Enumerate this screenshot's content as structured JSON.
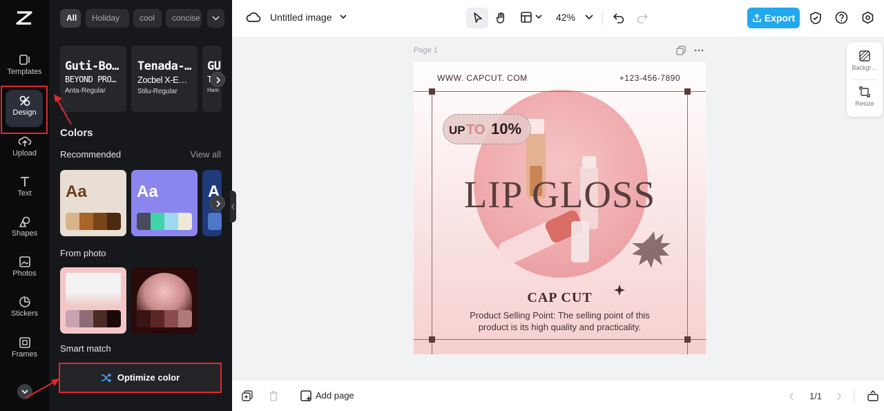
{
  "rail": {
    "items": [
      {
        "label": "Templates"
      },
      {
        "label": "Design"
      },
      {
        "label": "Upload"
      },
      {
        "label": "Text"
      },
      {
        "label": "Shapes"
      },
      {
        "label": "Photos"
      },
      {
        "label": "Stickers"
      },
      {
        "label": "Frames"
      }
    ],
    "active": "Design"
  },
  "panel": {
    "chips": [
      "All",
      "Holiday",
      "cool",
      "concise"
    ],
    "font_cards": [
      {
        "line1": "Guti-Bo…",
        "line2": "BEYOND PRO…",
        "line3": "Anta-Regular"
      },
      {
        "line1": "Tenada-…",
        "line2": "Zocbel X-E…",
        "line3": "Stilu-Regular"
      },
      {
        "line1": "GU",
        "line2": "T",
        "line3": "Ham"
      }
    ],
    "colors_title": "Colors",
    "recommended_label": "Recommended",
    "view_all": "View all",
    "palettes": [
      {
        "text": "Aa",
        "bg": "#e9ded3",
        "text_color": "#6b3d1c",
        "swatches": [
          "#d9b38a",
          "#a8662b",
          "#7a4419",
          "#4d2a12"
        ]
      },
      {
        "text": "Aa",
        "bg": "#8b85ef",
        "text_color": "#ffffff",
        "swatches": [
          "#4a4a5e",
          "#3fd3a8",
          "#9fd9ef",
          "#efe9d6"
        ]
      },
      {
        "text": "A",
        "bg": "#1f3a7a",
        "text_color": "#ffffff",
        "swatches": [
          "#5078c8"
        ]
      }
    ],
    "from_photo_label": "From photo",
    "photo_palettes": [
      {
        "swatches": [
          "#caa3b1",
          "#8f6c75",
          "#4a2c25",
          "#1c0a08"
        ]
      },
      {
        "swatches": [
          "#3a1414",
          "#5a2626",
          "#8a4c4c",
          "#b07a7a"
        ]
      }
    ],
    "smart_match_label": "Smart match",
    "optimize_label": "Optimize color"
  },
  "topbar": {
    "title": "Untitled image",
    "zoom": "42%",
    "export_label": "Export"
  },
  "canvas": {
    "page_label": "Page 1",
    "poster": {
      "website": "WWW. CAPCUT. COM",
      "phone": "+123-456-7890",
      "badge_up": "UP",
      "badge_to": "TO",
      "badge_pct": "10%",
      "headline": "LIP GLOSS",
      "brand": "CAP CUT",
      "description": "Product Selling Point: The selling point of this product is its high quality and practicality."
    }
  },
  "right_panel": {
    "items": [
      {
        "label": "Backgr…"
      },
      {
        "label": "Resize"
      }
    ]
  },
  "bottombar": {
    "add_page": "Add page",
    "page_count": "1/1"
  }
}
